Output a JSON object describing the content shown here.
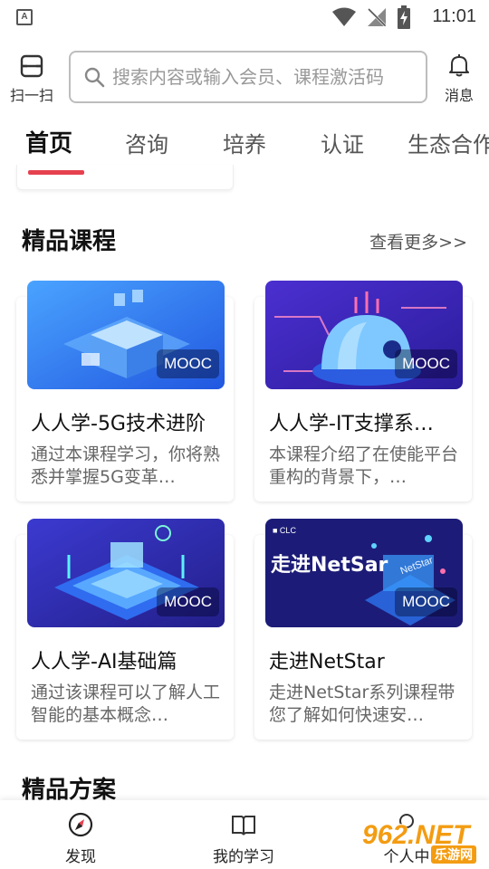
{
  "status_bar": {
    "app_icon_letter": "A",
    "time": "11:01"
  },
  "header": {
    "scan_label": "扫一扫",
    "search_placeholder": "搜索内容或输入会员、课程激活码",
    "messages_label": "消息"
  },
  "tabs": [
    "首页",
    "咨询",
    "培养",
    "认证",
    "生态合作"
  ],
  "sections": {
    "courses_title": "精品课程",
    "see_more": "查看更多>>",
    "solutions_title": "精品方案"
  },
  "courses": [
    {
      "title": "人人学-5G技术进阶",
      "desc": "通过本课程学习，你将熟悉并掌握5G变革…",
      "badge": "MOOC"
    },
    {
      "title": "人人学-IT支撑系…",
      "desc": "本课程介绍了在使能平台重构的背景下，…",
      "badge": "MOOC"
    },
    {
      "title": "人人学-AI基础篇",
      "desc": "通过该课程可以了解人工智能的基本概念…",
      "badge": "MOOC"
    },
    {
      "title": "走进NetStar",
      "desc": "走进NetStar系列课程带您了解如何快速安…",
      "badge": "MOOC",
      "thumb_text": "走进NetSar",
      "thumb_logo": "■ CLC",
      "thumb_sign": "NetStar"
    }
  ],
  "bottom_nav": {
    "discover": "发现",
    "my_learning": "我的学习",
    "third_partial": "个人中"
  },
  "watermark": {
    "main": "962.NET",
    "sub": "乐游网"
  },
  "colors": {
    "accent_red": "#e5414f",
    "thumb_blue": "#2e6ee8",
    "thumb_purple": "#3a2bb8",
    "thumb_navy": "#2d2a9e",
    "thumb_dark": "#1c1c78"
  }
}
